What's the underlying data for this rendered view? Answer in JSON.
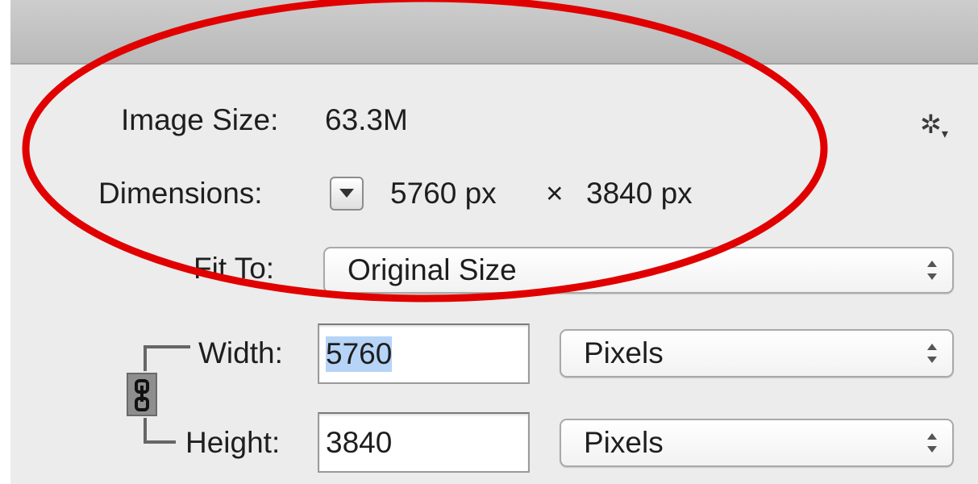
{
  "image_size": {
    "label": "Image Size:",
    "value": "63.3M"
  },
  "dimensions": {
    "label": "Dimensions:",
    "width": "5760 px",
    "times": "×",
    "height": "3840 px"
  },
  "fit_to": {
    "label": "Fit To:",
    "selected": "Original Size"
  },
  "width": {
    "label": "Width:",
    "value": "5760",
    "unit": "Pixels"
  },
  "height": {
    "label": "Height:",
    "value": "3840",
    "unit": "Pixels"
  },
  "icons": {
    "settings": "gear-icon",
    "dimensions_toggle": "chevron-down-icon",
    "constrain": "chain-link-icon"
  },
  "colors": {
    "annotation": "#e00000",
    "selection": "#b5d4f7",
    "panel": "#ececec"
  },
  "settings_glyph": "✲",
  "settings_caret": "▾"
}
